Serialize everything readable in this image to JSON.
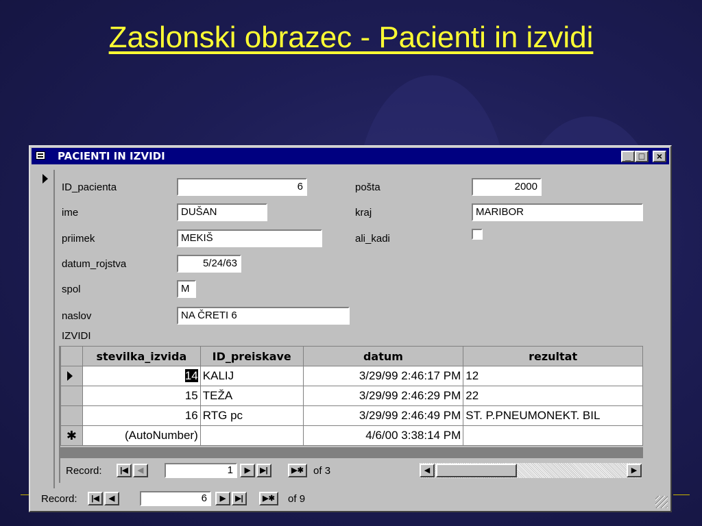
{
  "slide": {
    "title": "Zaslonski obrazec - Pacienti in izvidi"
  },
  "window": {
    "title": "PACIENTI IN IZVIDI",
    "controls": {
      "minimize": "_",
      "maximize": "□",
      "close": "×"
    }
  },
  "form": {
    "fields": [
      {
        "label": "ID_pacienta",
        "value": "6"
      },
      {
        "label": "ime",
        "value": "DUŠAN"
      },
      {
        "label": "priimek",
        "value": "MEKIŠ"
      },
      {
        "label": "datum_rojstva",
        "value": "5/24/63"
      },
      {
        "label": "spol",
        "value": "M"
      },
      {
        "label": "naslov",
        "value": "NA ČRETI 6"
      }
    ],
    "right_fields": [
      {
        "label": "pošta",
        "value": "2000"
      },
      {
        "label": "kraj",
        "value": "MARIBOR"
      },
      {
        "label": "ali_kadi",
        "checked": false
      }
    ],
    "subform_label": "IZVIDI"
  },
  "subform": {
    "columns": [
      "stevilka_izvida",
      "ID_preiskave",
      "datum",
      "rezultat"
    ],
    "rows": [
      {
        "stevilka_izvida": "14",
        "ID_preiskave": "KALIJ",
        "datum": "3/29/99 2:46:17 PM",
        "rezultat": "12",
        "current": true
      },
      {
        "stevilka_izvida": "15",
        "ID_preiskave": "TEŽA",
        "datum": "3/29/99 2:46:29 PM",
        "rezultat": "22"
      },
      {
        "stevilka_izvida": "16",
        "ID_preiskave": "RTG pc",
        "datum": "3/29/99 2:46:49 PM",
        "rezultat": "ST. P.PNEUMONEKT. BIL"
      }
    ],
    "new_row": {
      "marker": "✱",
      "stevilka_izvida": "(AutoNumber)",
      "datum": "4/6/00 3:38:14 PM"
    },
    "nav": {
      "label": "Record:",
      "current": "1",
      "of_label": "of",
      "total": "3"
    }
  },
  "main_nav": {
    "label": "Record:",
    "current": "6",
    "of_label": "of",
    "total": "9"
  },
  "colors": {
    "background": "#1d1d55",
    "title": "#ffff33",
    "titlebar": "#000080",
    "chrome": "#c0c0c0"
  }
}
